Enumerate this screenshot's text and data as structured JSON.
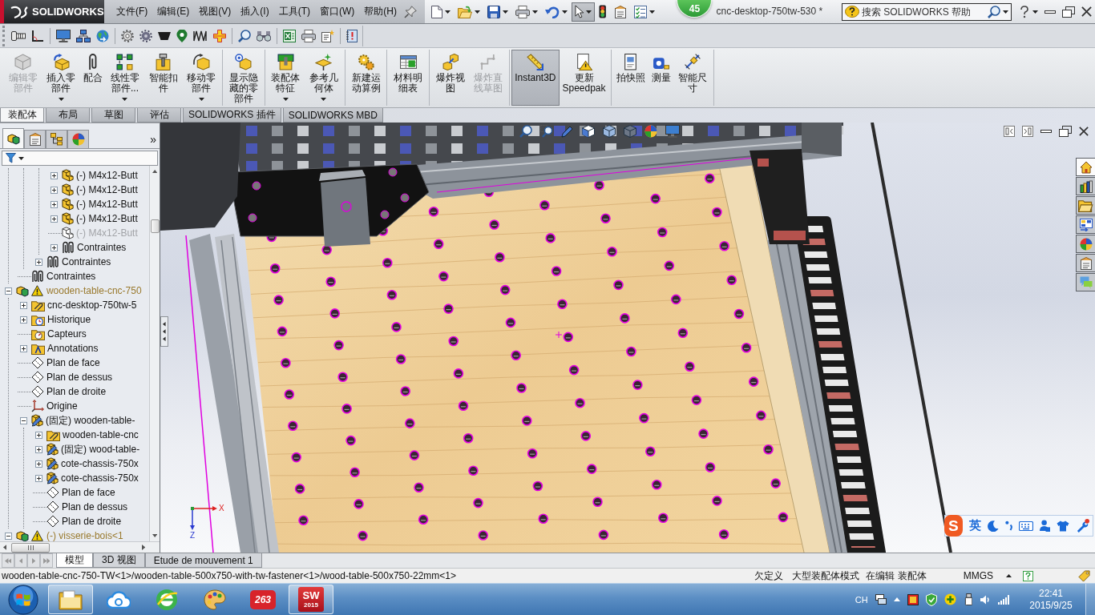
{
  "title_bar": {
    "logo": "SOLIDWORKS",
    "menu": [
      "文件(F)",
      "编辑(E)",
      "视图(V)",
      "插入(I)",
      "工具(T)",
      "窗口(W)",
      "帮助(H)"
    ],
    "select_tool": {
      "selected": true
    },
    "badge": "45",
    "document_title": "cnc-desktop-750tw-530 *",
    "search": {
      "placeholder": "搜索 SOLIDWORKS 帮助"
    }
  },
  "command_manager": {
    "groups": [
      {
        "buttons": [
          {
            "label": "编辑零部件",
            "disabled": true,
            "dropdown": false,
            "selected": false
          },
          {
            "label": "插入零部件",
            "disabled": false,
            "dropdown": true,
            "selected": false
          },
          {
            "label": "配合",
            "disabled": false,
            "dropdown": false,
            "selected": false
          },
          {
            "label": "线性零部件...",
            "disabled": false,
            "dropdown": true,
            "selected": false
          },
          {
            "label": "智能扣件",
            "disabled": false,
            "dropdown": false,
            "selected": false
          },
          {
            "label": "移动零部件",
            "disabled": false,
            "dropdown": true,
            "selected": false
          }
        ]
      },
      {
        "buttons": [
          {
            "label": "显示隐藏的零部件",
            "disabled": false,
            "dropdown": false,
            "selected": false
          }
        ]
      },
      {
        "buttons": [
          {
            "label": "装配体特征",
            "disabled": false,
            "dropdown": true,
            "selected": false
          },
          {
            "label": "参考几何体",
            "disabled": false,
            "dropdown": true,
            "selected": false
          }
        ]
      },
      {
        "buttons": [
          {
            "label": "新建运动算例",
            "disabled": false,
            "dropdown": false,
            "selected": false
          }
        ]
      },
      {
        "buttons": [
          {
            "label": "材料明细表",
            "disabled": false,
            "dropdown": false,
            "selected": false
          }
        ]
      },
      {
        "buttons": [
          {
            "label": "爆炸视图",
            "disabled": false,
            "dropdown": false,
            "selected": false
          },
          {
            "label": "爆炸直线草图",
            "disabled": true,
            "dropdown": false,
            "selected": false
          }
        ]
      },
      {
        "buttons": [
          {
            "label": "Instant3D",
            "disabled": false,
            "dropdown": false,
            "selected": true
          },
          {
            "label": "更新Speedpak",
            "disabled": false,
            "dropdown": false,
            "selected": false
          }
        ]
      },
      {
        "buttons": [
          {
            "label": "拍快照",
            "disabled": false,
            "dropdown": false,
            "selected": false
          },
          {
            "label": "测量",
            "disabled": false,
            "dropdown": false,
            "selected": false
          },
          {
            "label": "智能尺寸",
            "disabled": false,
            "dropdown": false,
            "selected": false
          }
        ]
      }
    ],
    "tabs": [
      {
        "label": "装配体",
        "selected": true
      },
      {
        "label": "布局",
        "selected": false
      },
      {
        "label": "草图",
        "selected": false
      },
      {
        "label": "评估",
        "selected": false
      },
      {
        "label": "SOLIDWORKS 插件",
        "selected": false
      },
      {
        "label": "SOLIDWORKS MBD",
        "selected": false
      }
    ]
  },
  "feature_manager": {
    "tabs": [
      {
        "selected": true
      },
      {
        "selected": false
      },
      {
        "selected": false
      },
      {
        "selected": false
      }
    ],
    "more": "»",
    "tree": [
      {
        "children": [
          {
            "children": [
              {
                "children": [
                  {
                    "label": "(-) M4x12-Butt",
                    "kind": "part",
                    "expanded": false,
                    "suppressed": false
                  },
                  {
                    "label": "(-) M4x12-Butt",
                    "kind": "part",
                    "expanded": false,
                    "suppressed": false
                  },
                  {
                    "label": "(-) M4x12-Butt",
                    "kind": "part",
                    "expanded": false,
                    "suppressed": false
                  },
                  {
                    "label": "(-) M4x12-Butt",
                    "kind": "part",
                    "expanded": false,
                    "suppressed": false
                  },
                  {
                    "label": "(-) M4x12-Butt",
                    "kind": "part",
                    "suppressed": true
                  },
                  {
                    "label": "Contraintes",
                    "kind": "mates",
                    "expanded": false,
                    "suppressed": false
                  }
                ]
              },
              {
                "label": "Contraintes",
                "kind": "mates",
                "expanded": false,
                "suppressed": false
              }
            ]
          },
          {
            "label": "Contraintes",
            "kind": "mates",
            "suppressed": false
          }
        ]
      },
      {
        "label": "wooden-table-cnc-750",
        "kind": "assembly",
        "warning": true,
        "expanded": true,
        "suppressed": false,
        "children": [
          {
            "label": "cnc-desktop-750tw-5",
            "kind": "folder",
            "expanded": false,
            "suppressed": false
          },
          {
            "label": "Historique",
            "kind": "history",
            "expanded": false,
            "suppressed": false
          },
          {
            "label": "Capteurs",
            "kind": "sensors",
            "suppressed": false
          },
          {
            "label": "Annotations",
            "kind": "annotations",
            "expanded": false,
            "suppressed": false
          },
          {
            "label": "Plan de face",
            "kind": "plane",
            "suppressed": false
          },
          {
            "label": "Plan de dessus",
            "kind": "plane",
            "suppressed": false
          },
          {
            "label": "Plan de droite",
            "kind": "plane",
            "suppressed": false
          },
          {
            "label": "Origine",
            "kind": "origin",
            "suppressed": false
          },
          {
            "label": "(固定) wooden-table-",
            "kind": "part-edit",
            "expanded": true,
            "suppressed": false,
            "children": [
              {
                "label": "wooden-table-cnc",
                "kind": "folder",
                "expanded": false,
                "suppressed": false
              },
              {
                "label": "(固定) wood-table-",
                "kind": "part-edit",
                "expanded": false,
                "suppressed": false
              },
              {
                "label": "cote-chassis-750x",
                "kind": "part-edit",
                "expanded": false,
                "suppressed": false
              },
              {
                "label": "cote-chassis-750x",
                "kind": "part-edit",
                "expanded": false,
                "suppressed": false
              },
              {
                "label": "Plan de face",
                "kind": "plane",
                "suppressed": false
              },
              {
                "label": "Plan de dessus",
                "kind": "plane",
                "suppressed": false
              },
              {
                "label": "Plan de droite",
                "kind": "plane",
                "suppressed": false
              }
            ]
          }
        ]
      },
      {
        "label": "(-) visserie-bois<1",
        "kind": "assembly",
        "warning": true,
        "expanded": true,
        "suppressed": false
      }
    ]
  },
  "graphics_area": {
    "task_pane_tabs": [
      {
        "selected": true
      },
      {
        "selected": false
      },
      {
        "selected": false
      },
      {
        "selected": false
      },
      {
        "selected": false
      },
      {
        "selected": false
      },
      {
        "selected": false
      }
    ],
    "triad": {
      "x_label": "X",
      "z_label": "Z"
    },
    "ime": {
      "logo": "S",
      "mode": "英"
    }
  },
  "model_tabs": [
    {
      "label": "模型",
      "selected": true
    },
    {
      "label": "3D 视图",
      "selected": false
    },
    {
      "label": "Etude de mouvement 1",
      "selected": false
    }
  ],
  "status_bar": {
    "path": "wooden-table-cnc-750-TW<1>/wooden-table-500x750-with-tw-fastener<1>/wood-table-500x750-22mm<1>",
    "items": [
      "欠定义",
      "大型装配体模式",
      "在编辑 装配体",
      "MMGS"
    ]
  },
  "taskbar": {
    "apps": [
      {
        "kind": "folder",
        "running": true
      },
      {
        "kind": "cloud",
        "running": false
      },
      {
        "kind": "browser",
        "running": false
      },
      {
        "kind": "palette",
        "running": false
      },
      {
        "kind": "mail",
        "running": false,
        "logo_text": "263"
      },
      {
        "kind": "solidworks",
        "running": true,
        "logo_text": "SW",
        "version": "2015"
      }
    ],
    "language": "CH",
    "time": "22:41",
    "date": "2015/9/25"
  }
}
